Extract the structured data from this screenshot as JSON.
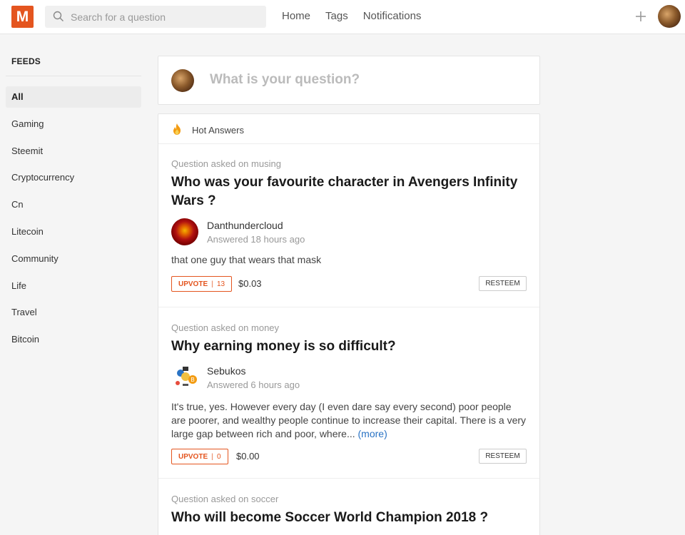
{
  "header": {
    "logo_letter": "M",
    "search_placeholder": "Search for a question",
    "nav": [
      "Home",
      "Tags",
      "Notifications"
    ]
  },
  "sidebar": {
    "title": "FEEDS",
    "items": [
      {
        "label": "All",
        "active": true
      },
      {
        "label": "Gaming"
      },
      {
        "label": "Steemit"
      },
      {
        "label": "Cryptocurrency"
      },
      {
        "label": "Cn"
      },
      {
        "label": "Litecoin"
      },
      {
        "label": "Community"
      },
      {
        "label": "Life"
      },
      {
        "label": "Travel"
      },
      {
        "label": "Bitcoin"
      }
    ]
  },
  "ask": {
    "placeholder": "What is your question?"
  },
  "hot": {
    "label": "Hot Answers"
  },
  "posts": [
    {
      "meta": "Question asked on musing",
      "title": "Who was your favourite character in Avengers Infinity Wars ?",
      "author": "Danthundercloud",
      "time": "Answered 18 hours ago",
      "body": "that one guy that wears that mask",
      "more": "",
      "upvote_label": "UPVOTE",
      "upvotes": "13",
      "payout": "$0.03",
      "resteem_label": "RESTEEM"
    },
    {
      "meta": "Question asked on money",
      "title": "Why earning money is so difficult?",
      "author": "Sebukos",
      "time": "Answered 6 hours ago",
      "body": "It's true, yes. However every day (I even dare say every second) poor people are poorer, and wealthy people continue to increase their capital. There is a very large gap between rich and poor, where...",
      "more": "(more)",
      "upvote_label": "UPVOTE",
      "upvotes": "0",
      "payout": "$0.00",
      "resteem_label": "RESTEEM"
    },
    {
      "meta": "Question asked on soccer",
      "title": "Who will become Soccer World Champion 2018 ?"
    }
  ],
  "colors": {
    "accent": "#e4551f",
    "link": "#2a73c4"
  }
}
